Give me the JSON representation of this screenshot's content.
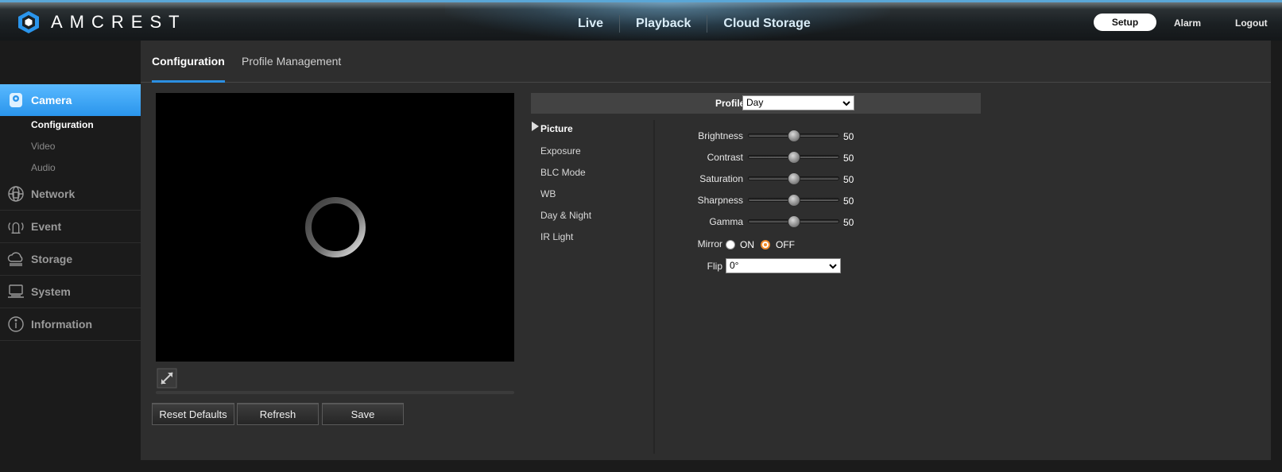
{
  "brand": {
    "name": "AMCREST"
  },
  "nav": {
    "live": "Live",
    "playback": "Playback",
    "cloud": "Cloud Storage",
    "setup": "Setup",
    "alarm": "Alarm",
    "logout": "Logout"
  },
  "sidebar": {
    "camera": {
      "label": "Camera",
      "icon": "camera-icon"
    },
    "sub_items": [
      "Configuration",
      "Video",
      "Audio"
    ],
    "items": [
      {
        "label": "Network",
        "icon": "network-icon"
      },
      {
        "label": "Event",
        "icon": "event-icon"
      },
      {
        "label": "Storage",
        "icon": "storage-icon"
      },
      {
        "label": "System",
        "icon": "system-icon"
      },
      {
        "label": "Information",
        "icon": "information-icon"
      }
    ]
  },
  "tabs": [
    "Configuration",
    "Profile Management"
  ],
  "profile": {
    "label": "Profile",
    "value": "Day"
  },
  "settings_menu": [
    "Picture",
    "Exposure",
    "BLC Mode",
    "WB",
    "Day & Night",
    "IR Light"
  ],
  "picture": {
    "sliders": [
      {
        "label": "Brightness",
        "value": 50
      },
      {
        "label": "Contrast",
        "value": 50
      },
      {
        "label": "Saturation",
        "value": 50
      },
      {
        "label": "Sharpness",
        "value": 50
      },
      {
        "label": "Gamma",
        "value": 50
      }
    ],
    "mirror": {
      "label": "Mirror",
      "on": "ON",
      "off": "OFF",
      "selected": "OFF"
    },
    "flip": {
      "label": "Flip",
      "value": "0°"
    }
  },
  "buttons": {
    "reset": "Reset Defaults",
    "refresh": "Refresh",
    "save": "Save"
  },
  "colors": {
    "accent": "#2a95ec",
    "radio_selected": "#f08b2a"
  }
}
